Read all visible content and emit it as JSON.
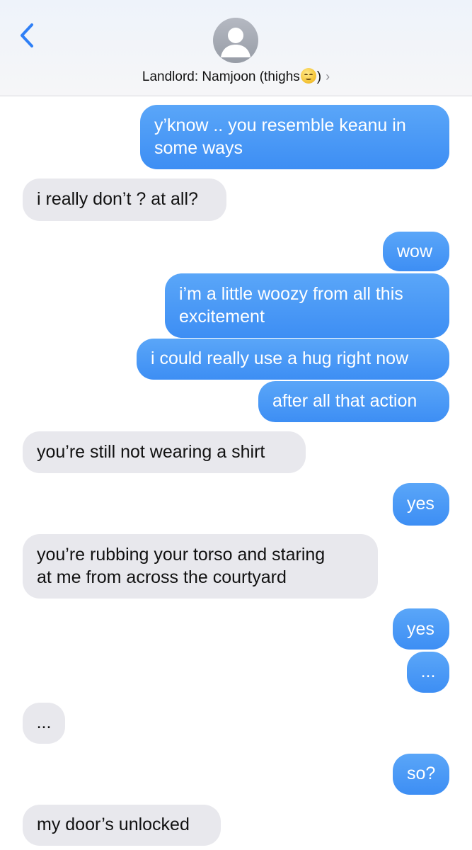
{
  "header": {
    "back_label": "Back",
    "contact_name_prefix": "Landlord: Namjoon (thighs",
    "contact_name_emoji": "relieved-face-emoji",
    "contact_name_suffix": ")",
    "chevron": "›"
  },
  "colors": {
    "outgoing_bubble": "#3e8ff4",
    "incoming_bubble": "#e8e8ed",
    "accent": "#2f7ff6"
  },
  "messages": [
    {
      "direction": "outgoing",
      "lines": [
        "y’know .. you resemble keanu in",
        "some ways"
      ]
    },
    {
      "direction": "incoming",
      "lines": [
        "i really don’t ? at all?"
      ]
    },
    {
      "direction": "outgoing",
      "lines": [
        "wow"
      ]
    },
    {
      "direction": "outgoing",
      "lines": [
        "i’m a little woozy from all this",
        "excitement"
      ]
    },
    {
      "direction": "outgoing",
      "lines": [
        "i could really use a hug right now"
      ]
    },
    {
      "direction": "outgoing",
      "lines": [
        "after all that action"
      ]
    },
    {
      "direction": "incoming",
      "lines": [
        "you’re still not wearing a shirt"
      ]
    },
    {
      "direction": "outgoing",
      "lines": [
        "yes"
      ]
    },
    {
      "direction": "incoming",
      "lines": [
        "you’re rubbing your torso and staring",
        "at me from across the courtyard"
      ]
    },
    {
      "direction": "outgoing",
      "lines": [
        "yes"
      ]
    },
    {
      "direction": "outgoing",
      "lines": [
        "..."
      ]
    },
    {
      "direction": "incoming",
      "lines": [
        "..."
      ]
    },
    {
      "direction": "outgoing",
      "lines": [
        "so?"
      ]
    },
    {
      "direction": "incoming",
      "lines": [
        "my door’s unlocked"
      ]
    }
  ]
}
